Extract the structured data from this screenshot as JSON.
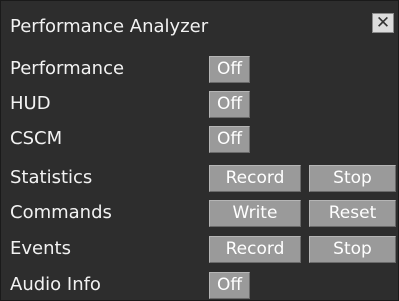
{
  "window": {
    "title": "Performance Analyzer",
    "close_glyph": "✕"
  },
  "rows": [
    {
      "label": "Performance",
      "buttons": [
        "Off"
      ]
    },
    {
      "label": "HUD",
      "buttons": [
        "Off"
      ]
    },
    {
      "label": "CSCM",
      "buttons": [
        "Off"
      ]
    },
    {
      "label": "Statistics",
      "buttons": [
        "Record",
        "Stop"
      ]
    },
    {
      "label": "Commands",
      "buttons": [
        "Write",
        "Reset"
      ]
    },
    {
      "label": "Events",
      "buttons": [
        "Record",
        "Stop"
      ]
    },
    {
      "label": "Audio Info",
      "buttons": [
        "Off"
      ]
    }
  ]
}
